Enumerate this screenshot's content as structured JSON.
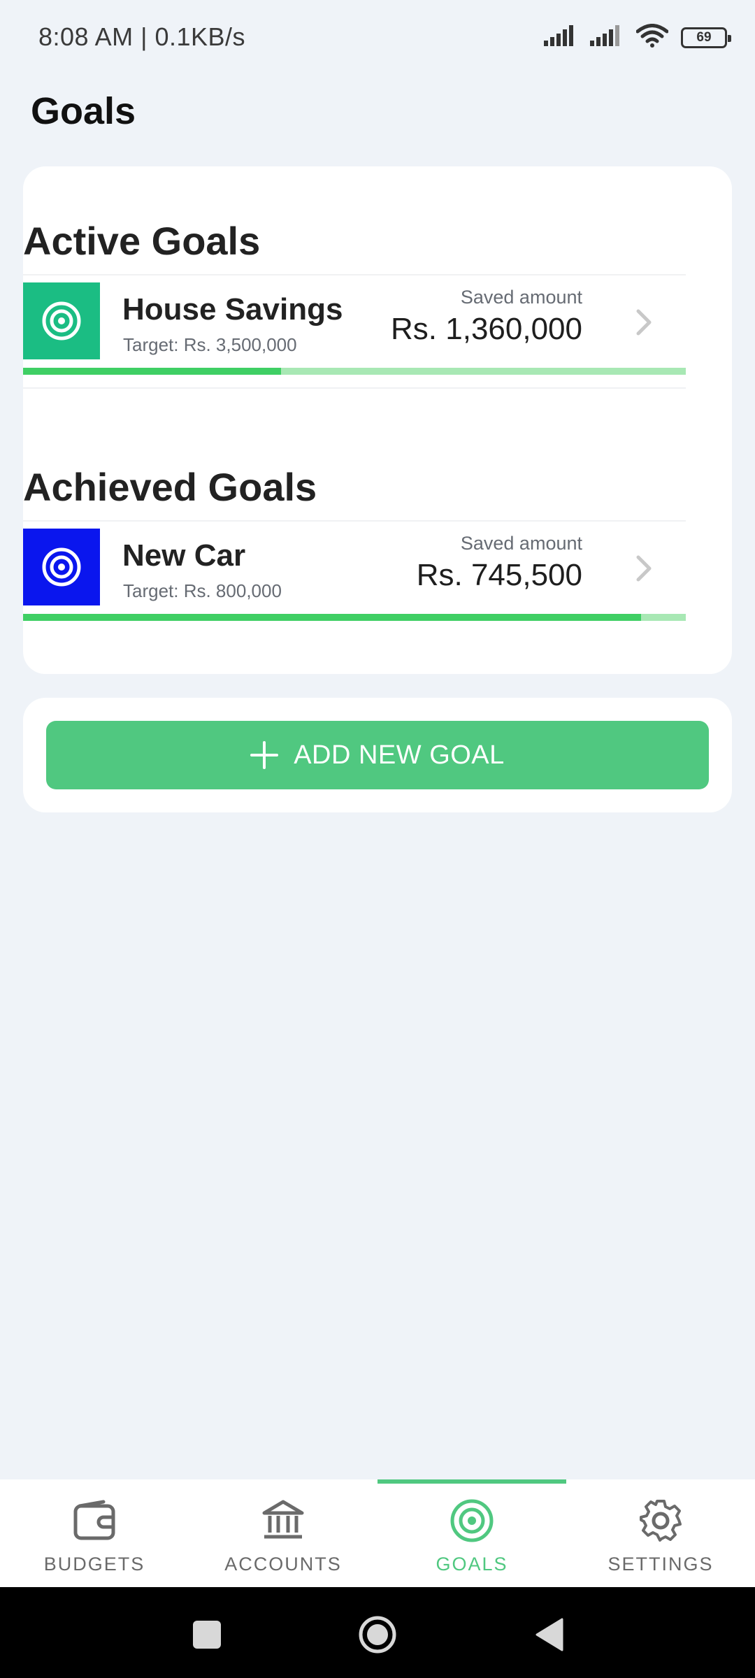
{
  "status_bar": {
    "time": "8:08 AM | 0.1KB/s",
    "battery": "69",
    "icons": [
      "signal-icon",
      "signal-icon",
      "wifi-icon",
      "battery-icon"
    ]
  },
  "page": {
    "title": "Goals"
  },
  "active_goals": {
    "title": "Active Goals",
    "items": [
      {
        "name": "House Savings",
        "target": "Target: Rs. 3,500,000",
        "saved_label": "Saved amount",
        "saved_amount": "Rs. 1,360,000",
        "progress_fraction": 0.389,
        "icon": "target-icon",
        "icon_color": "#1bbd83"
      }
    ]
  },
  "achieved_goals": {
    "title": "Achieved Goals",
    "items": [
      {
        "name": "New Car",
        "target": "Target: Rs. 800,000",
        "saved_label": "Saved amount",
        "saved_amount": "Rs. 745,500",
        "progress_fraction": 0.932,
        "icon": "target-icon",
        "icon_color": "#0a16ee"
      }
    ]
  },
  "add_goal": {
    "label": "ADD NEW GOAL",
    "icon": "plus-icon"
  },
  "bottom_nav": {
    "items": [
      {
        "label": "BUDGETS",
        "icon": "wallet-icon",
        "active": false
      },
      {
        "label": "ACCOUNTS",
        "icon": "bank-icon",
        "active": false
      },
      {
        "label": "GOALS",
        "icon": "target-icon",
        "active": true
      },
      {
        "label": "SETTINGS",
        "icon": "gear-icon",
        "active": false
      }
    ]
  },
  "colors": {
    "accent": "#50c880",
    "progress_fill": "#3fcf64",
    "progress_track": "#a8e8b4",
    "background": "#eff3f8"
  },
  "system_nav": {
    "icons": [
      "recents-icon",
      "home-icon",
      "back-icon"
    ]
  }
}
